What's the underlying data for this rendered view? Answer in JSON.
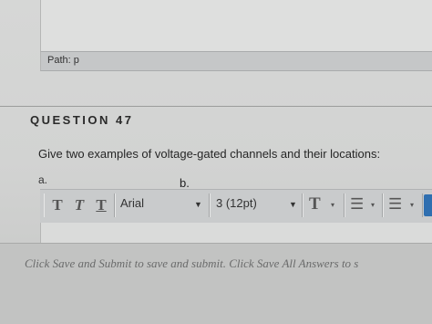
{
  "previous_editor": {
    "path_label": "Path: p"
  },
  "question": {
    "title": "QUESTION 47",
    "text": "Give two examples of voltage-gated channels and their locations:",
    "label_a": "a.",
    "label_b": "b."
  },
  "toolbar": {
    "bold_glyph": "T",
    "italic_glyph": "T",
    "underline_glyph": "T",
    "font_family_value": "Arial",
    "font_size_value": "3 (12pt)",
    "text_color_glyph": "T",
    "dropdown_arrow": "▼",
    "small_arrow": "▾",
    "bullet_list_glyph": "☰",
    "numbered_list_glyph": "☰"
  },
  "footer": {
    "instructions": "Click Save and Submit to save and submit. Click Save All Answers to s"
  },
  "colors": {
    "accent_blue": "#2f6fb0",
    "background": "#d2d3d2"
  }
}
